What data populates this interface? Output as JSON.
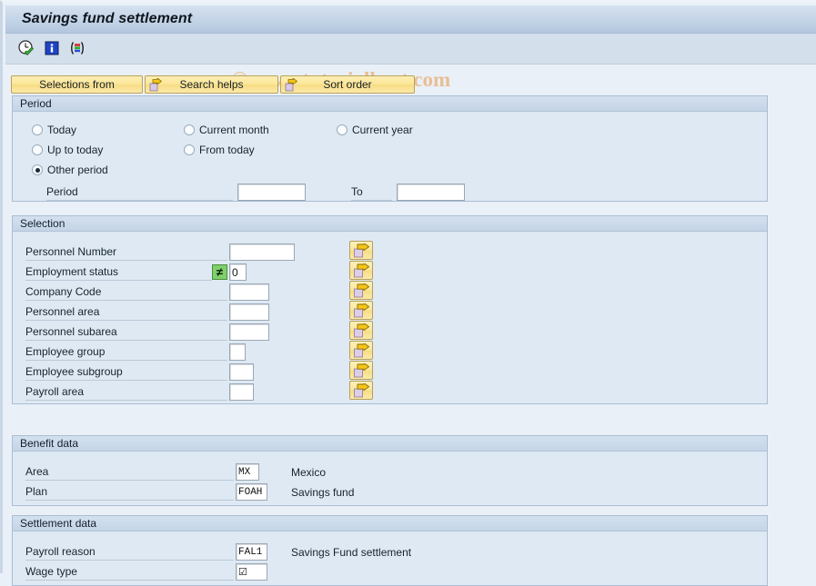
{
  "window": {
    "title": "Savings fund settlement"
  },
  "watermark": "© www.tutorialkart.com",
  "toolbar": {
    "icons": [
      {
        "name": "execute-clock-check-icon",
        "title": "Execute"
      },
      {
        "name": "information-icon",
        "title": "Information"
      },
      {
        "name": "variant-bars-icon",
        "title": "Get Variant"
      }
    ]
  },
  "buttons": [
    {
      "label": "Selections from",
      "icon": null
    },
    {
      "label": "Search helps",
      "icon": "arrow-right-icon"
    },
    {
      "label": "Sort order",
      "icon": "arrow-right-icon"
    }
  ],
  "period": {
    "title": "Period",
    "options": [
      {
        "label": "Today",
        "selected": false
      },
      {
        "label": "Current month",
        "selected": false
      },
      {
        "label": "Current year",
        "selected": false
      },
      {
        "label": "Up to today",
        "selected": false
      },
      {
        "label": "From today",
        "selected": false
      },
      {
        "label": "Other period",
        "selected": true
      }
    ],
    "period_label": "Period",
    "period_value": "",
    "to_label": "To",
    "to_value": ""
  },
  "selection": {
    "title": "Selection",
    "rows": [
      {
        "label": "Personnel Number",
        "operator": null,
        "value": "",
        "field_width": 72,
        "has_arrow": true
      },
      {
        "label": "Employment status",
        "operator": "≠",
        "value": "0",
        "field_width": 17,
        "has_arrow": true
      },
      {
        "label": "Company Code",
        "operator": null,
        "value": "",
        "field_width": 44,
        "has_arrow": true
      },
      {
        "label": "Personnel area",
        "operator": null,
        "value": "",
        "field_width": 44,
        "has_arrow": true
      },
      {
        "label": "Personnel subarea",
        "operator": null,
        "value": "",
        "field_width": 44,
        "has_arrow": true
      },
      {
        "label": "Employee group",
        "operator": null,
        "value": "",
        "field_width": 17,
        "has_arrow": true
      },
      {
        "label": "Employee subgroup",
        "operator": null,
        "value": "",
        "field_width": 26,
        "has_arrow": true
      },
      {
        "label": "Payroll area",
        "operator": null,
        "value": "",
        "field_width": 26,
        "has_arrow": true
      }
    ]
  },
  "benefit_data": {
    "title": "Benefit data",
    "rows": [
      {
        "label": "Area",
        "value": "MX",
        "description": "Mexico",
        "field_width": 26
      },
      {
        "label": "Plan",
        "value": "FOAH",
        "description": "Savings fund",
        "field_width": 35
      }
    ]
  },
  "settlement_data": {
    "title": "Settlement data",
    "rows": [
      {
        "label": "Payroll reason",
        "value": "FAL1",
        "description": "Savings Fund settlement",
        "field_width": 35
      },
      {
        "label": "Wage type",
        "value": "☑",
        "description": "",
        "field_width": 35
      }
    ]
  }
}
